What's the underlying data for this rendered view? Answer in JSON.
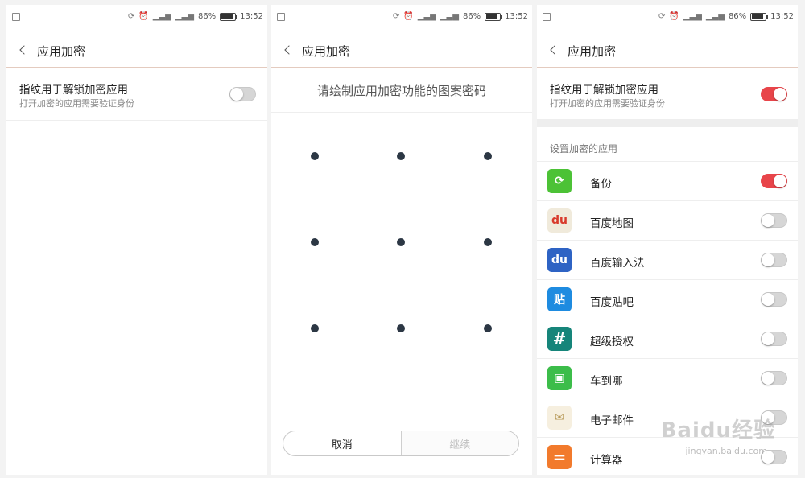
{
  "statusbar": {
    "battery": "86%",
    "time": "13:52",
    "battery_level": 0.86
  },
  "screen1": {
    "title": "应用加密",
    "fingerprint": {
      "title": "指纹用于解锁加密应用",
      "subtitle": "打开加密的应用需要验证身份",
      "enabled": false
    }
  },
  "screen2": {
    "title": "应用加密",
    "prompt": "请绘制应用加密功能的图案密码",
    "cancel_label": "取消",
    "continue_label": "继续"
  },
  "screen3": {
    "title": "应用加密",
    "fingerprint": {
      "title": "指纹用于解锁加密应用",
      "subtitle": "打开加密的应用需要验证身份",
      "enabled": true
    },
    "section_label": "设置加密的应用",
    "apps": [
      {
        "name": "备份",
        "icon": "backup-icon",
        "color": "#4cc236",
        "enabled": true
      },
      {
        "name": "百度地图",
        "icon": "baidu-map-icon",
        "color": "#f0eadb",
        "enabled": false
      },
      {
        "name": "百度输入法",
        "icon": "baidu-input-icon",
        "color": "#2e63c4",
        "enabled": false
      },
      {
        "name": "百度贴吧",
        "icon": "baidu-tieba-icon",
        "color": "#1e8be0",
        "enabled": false
      },
      {
        "name": "超级授权",
        "icon": "hash-icon",
        "color": "#16857a",
        "enabled": false
      },
      {
        "name": "车到哪",
        "icon": "bus-icon",
        "color": "#3cbd4a",
        "enabled": false
      },
      {
        "name": "电子邮件",
        "icon": "email-icon",
        "color": "#f6efdf",
        "enabled": false
      },
      {
        "name": "计算器",
        "icon": "calculator-icon",
        "color": "#f27a2c",
        "enabled": false
      }
    ]
  },
  "watermark": {
    "text": "Baidu经验",
    "url": "jingyan.baidu.com"
  }
}
